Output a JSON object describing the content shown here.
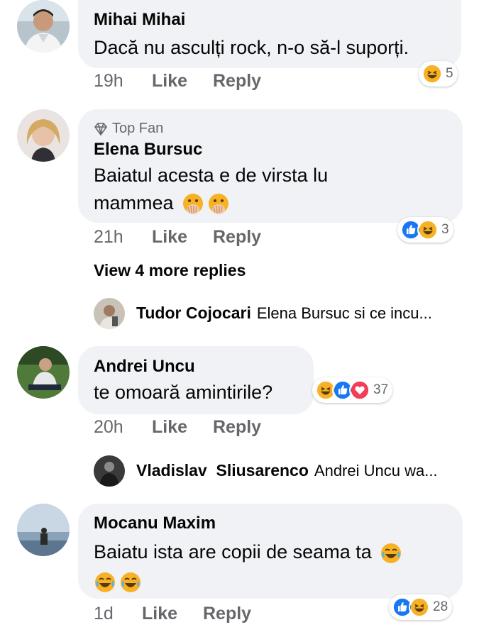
{
  "comments": [
    {
      "author": "Mihai Mihai",
      "text": "Dacă nu asculți rock, n-o să-l suporți.",
      "time": "19h",
      "like": "Like",
      "reply": "Reply",
      "reaction_count": "5",
      "reactions": [
        "haha-icon"
      ]
    },
    {
      "badge": "Top Fan",
      "author": "Elena Bursuc",
      "text_line1": "Baiatul acesta e de virsta lu",
      "text_line2": "mammea",
      "time": "21h",
      "like": "Like",
      "reply": "Reply",
      "reaction_count": "3",
      "reactions": [
        "like-icon",
        "haha-icon"
      ],
      "view_more": "View 4 more replies",
      "reply_preview": {
        "author": "Tudor Cojocari",
        "text": "Elena Bursuc si ce incu..."
      }
    },
    {
      "author": "Andrei Uncu",
      "text": "te omoară amintirile?",
      "time": "20h",
      "like": "Like",
      "reply": "Reply",
      "reaction_count": "37",
      "reactions": [
        "haha-icon",
        "like-icon",
        "love-icon"
      ],
      "reply_preview": {
        "author": "Vladislav  Sliusarenco",
        "text": "Andrei Uncu wa..."
      }
    },
    {
      "author": "Mocanu Maxim",
      "text_line1": "Baiatu ista are copii de seama ta",
      "time": "1d",
      "like": "Like",
      "reply": "Reply",
      "reaction_count": "28",
      "reactions": [
        "like-icon",
        "haha-icon"
      ]
    }
  ],
  "colors": {
    "bubble": "#f0f2f5",
    "secondary_text": "#65676b",
    "like_blue": "#1877f2",
    "love_red": "#f33e58",
    "haha_yellow": "#f7b125"
  }
}
